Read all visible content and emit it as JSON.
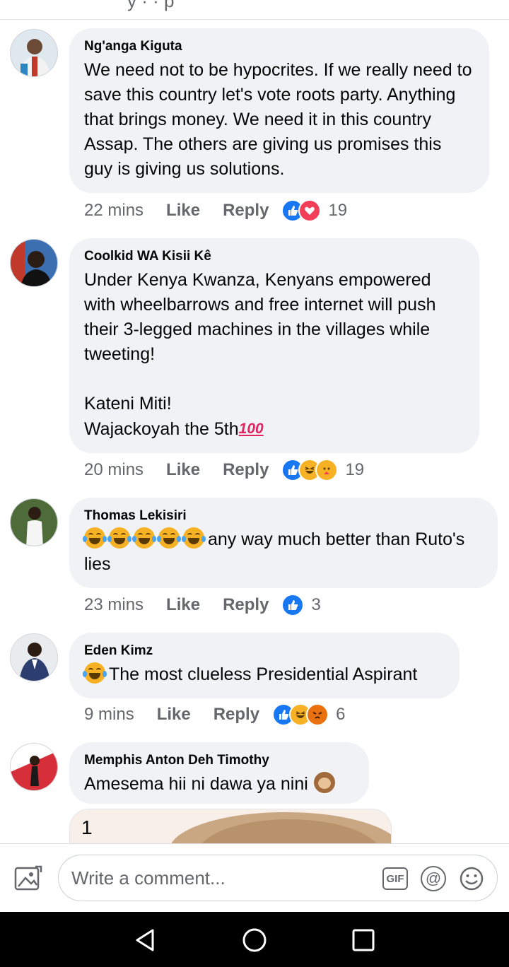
{
  "header": {
    "partial_text": "y · · p"
  },
  "comments": [
    {
      "author": "Ng'anga Kiguta",
      "text": "We need not to be hypocrites. If we really need to save this country let's vote roots party. Anything that brings money. We need it in this country Assap. The others are giving us promises this guy is giving us solutions.",
      "time": "22 mins",
      "like_label": "Like",
      "reply_label": "Reply",
      "reactions": [
        "like",
        "love"
      ],
      "reaction_count": "19"
    },
    {
      "author": "Coolkid WA Kisii Kê",
      "text": "Under Kenya Kwanza, Kenyans empowered with wheelbarrows and free internet will push their 3-legged machines in the villages while tweeting!\n\nKateni Miti!\nWajackoyah the 5th",
      "emoji_suffix": "100",
      "time": "20 mins",
      "like_label": "Like",
      "reply_label": "Reply",
      "reactions": [
        "like",
        "haha",
        "care"
      ],
      "reaction_count": "19"
    },
    {
      "author": "Thomas Lekisiri",
      "text": "any way much better than Ruto's lies",
      "emoji_prefix": [
        "laughing-tears",
        "laughing-tears",
        "laughing-tears",
        "laughing-tears",
        "laughing-tears"
      ],
      "time": "23 mins",
      "like_label": "Like",
      "reply_label": "Reply",
      "reactions": [
        "like"
      ],
      "reaction_count": "3"
    },
    {
      "author": "Eden Kimz",
      "text": "The most clueless Presidential Aspirant",
      "emoji_prefix": [
        "laughing-tears"
      ],
      "time": "9 mins",
      "like_label": "Like",
      "reply_label": "Reply",
      "reactions": [
        "like",
        "haha",
        "angry"
      ],
      "reaction_count": "6"
    },
    {
      "author": "Memphis Anton Deh Timothy",
      "text": "Amesema hii ni dawa ya nini",
      "emoji_suffix_icon": "monkey",
      "attachment_text": "1"
    }
  ],
  "composer": {
    "placeholder": "Write a comment...",
    "gif_label": "GIF",
    "at_label": "@"
  },
  "colors": {
    "bubble": "#f0f2f5",
    "like_blue": "#1877f2",
    "love_red": "#f33e58",
    "haha_yellow": "#f7b125",
    "angry_orange": "#e9710f",
    "secondary_text": "#65676b"
  }
}
